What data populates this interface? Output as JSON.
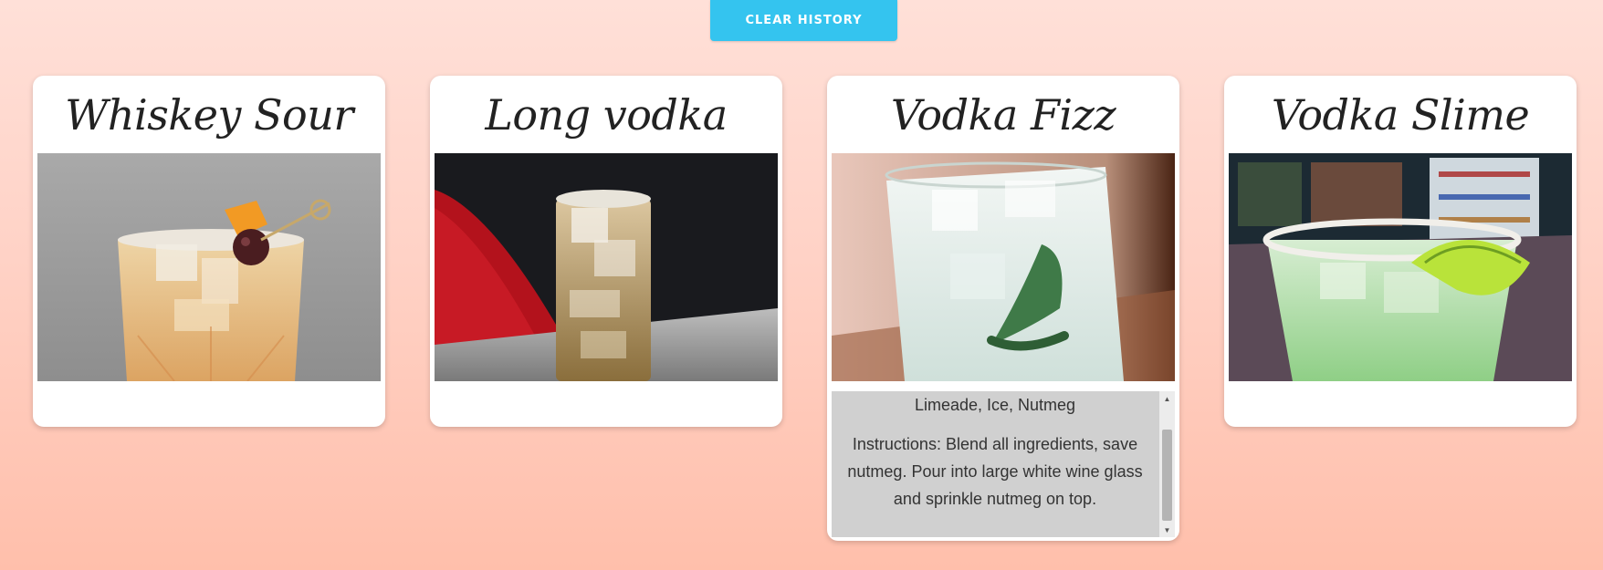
{
  "header": {
    "clear_label": "CLEAR HISTORY"
  },
  "cards": [
    {
      "name": "Whiskey Sour"
    },
    {
      "name": "Long vodka"
    },
    {
      "name": "Vodka Fizz",
      "ingredients_tail": "Limeade, Ice, Nutmeg",
      "instructions": "Instructions: Blend all ingredients, save nutmeg. Pour into large white wine glass and sprinkle nutmeg on top."
    },
    {
      "name": "Vodka Slime"
    }
  ],
  "colors": {
    "accent": "#34c4ef",
    "bg_top": "#ffe0d8",
    "bg_bottom": "#ffbfab"
  }
}
